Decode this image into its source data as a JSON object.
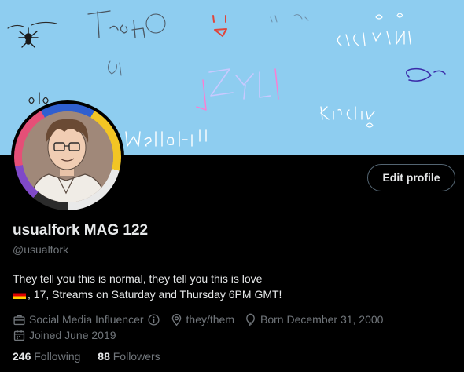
{
  "banner": {
    "doodles": [
      "Spiderscircle",
      "Trash",
      "glitch:)",
      "CASEYYDUH",
      "Sage",
      "Kirstino",
      "Mellohi!!",
      "ZYLE"
    ]
  },
  "profile": {
    "edit_label": "Edit profile",
    "display_name": "usualfork MAG 122",
    "handle": "@usualfork",
    "bio_line1": "They tell you this is normal, they tell you this is love",
    "bio_line2": ", 17, Streams on Saturday and Thursday 6PM GMT!",
    "category": "Social Media Influencer",
    "pronouns": "they/them",
    "born": "Born December 31, 2000",
    "joined": "Joined June 2019",
    "following_count": "246",
    "following_label": "Following",
    "followers_count": "88",
    "followers_label": "Followers"
  },
  "colors": {
    "banner": "#8ecdf0",
    "background": "#000000",
    "text": "#e7e9ea",
    "muted": "#71767b",
    "button_border": "#536471"
  }
}
